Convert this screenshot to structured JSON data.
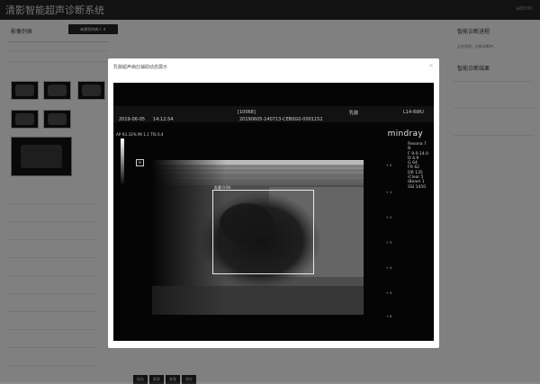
{
  "app": {
    "title": "清影智能超声诊断系统",
    "user": "admin"
  },
  "left": {
    "list_title": "影像列表",
    "upload_label": "新建您的病人 ⬆"
  },
  "right": {
    "process_title": "智能诊断进程",
    "process_text": "正在排序，分析诊断中...",
    "result_title": "智能诊断结果"
  },
  "bottom_buttons": [
    "报告",
    "图表",
    "查看",
    "保存"
  ],
  "modal": {
    "title": "乳腺超声病灶辅助动态展示",
    "close": "×"
  },
  "viewer": {
    "header_center": "[10068]",
    "header_right1": "乳腺",
    "header_right2": "L14-6WU",
    "date": "2019-06-05",
    "time": "14:12:54",
    "patient_id": "20190605-140713-CEB0G0-0001152",
    "left_info": "AP 93.33%  MI 1.1  TIS 0.4",
    "brand": "mindray",
    "params": [
      "Resona 7",
      "B",
      "F 9.0-14.0",
      "D 4.9",
      "G 64",
      "FR 62",
      "DR 135",
      "iClear 5",
      "iBeam 1",
      "SSI 1450"
    ],
    "roi_label": "乳腺 0.94"
  }
}
